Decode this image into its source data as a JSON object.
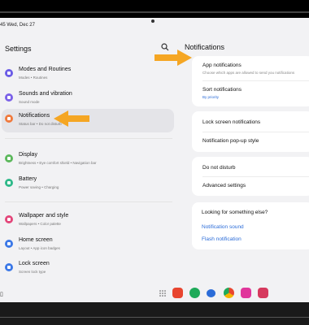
{
  "status_time": "45  Wed, Dec 27",
  "left_panel": {
    "title": "Settings",
    "items": [
      {
        "title": "Modes and Routines",
        "subtitle": "Modes  •  Routines",
        "icon": "modes-icon",
        "color": "#6b5ce6"
      },
      {
        "title": "Sounds and vibration",
        "subtitle": "Sound mode",
        "icon": "sound-icon",
        "color": "#7b61e8"
      },
      {
        "title": "Notifications",
        "subtitle": "Status bar  •  Do not disturb",
        "icon": "bell-icon",
        "color": "#f07a3d"
      },
      {
        "title": "Display",
        "subtitle": "Brightness  •  Eye comfort shield  •  Navigation bar",
        "icon": "display-icon",
        "color": "#5cb85c"
      },
      {
        "title": "Battery",
        "subtitle": "Power saving  •  Charging",
        "icon": "battery-icon",
        "color": "#2fb98a"
      },
      {
        "title": "Wallpaper and style",
        "subtitle": "Wallpapers  •  Color palette",
        "icon": "palette-icon",
        "color": "#e3467a"
      },
      {
        "title": "Home screen",
        "subtitle": "Layout  •  App icon badges",
        "icon": "home-icon",
        "color": "#3b78e7"
      },
      {
        "title": "Lock screen",
        "subtitle": "Screen lock type",
        "icon": "lock-icon",
        "color": "#3b78e7"
      }
    ]
  },
  "right_panel": {
    "title": "Notifications",
    "card1": [
      {
        "title": "App notifications",
        "subtitle": "Choose which apps are allowed to send you notifications"
      },
      {
        "title": "Sort notifications",
        "subtitle": "By priority"
      }
    ],
    "card2": [
      {
        "title": "Lock screen notifications"
      },
      {
        "title": "Notification pop-up style"
      }
    ],
    "card3": [
      {
        "title": "Do not disturb"
      },
      {
        "title": "Advanced settings"
      }
    ],
    "looking": {
      "title": "Looking for something else?",
      "links": [
        "Notification sound",
        "Flash notification"
      ]
    }
  },
  "dock": [
    {
      "icon": "app-red-icon",
      "color": "#e8452f"
    },
    {
      "icon": "app-green-icon",
      "color": "#1faa59"
    },
    {
      "icon": "messages-icon",
      "color": "#2b6cd8"
    },
    {
      "icon": "chrome-icon",
      "color": "#f5b400"
    },
    {
      "icon": "flower-icon",
      "color": "#e0369b"
    },
    {
      "icon": "camera-icon",
      "color": "#d63a5e"
    }
  ],
  "accent": "#f5a623"
}
